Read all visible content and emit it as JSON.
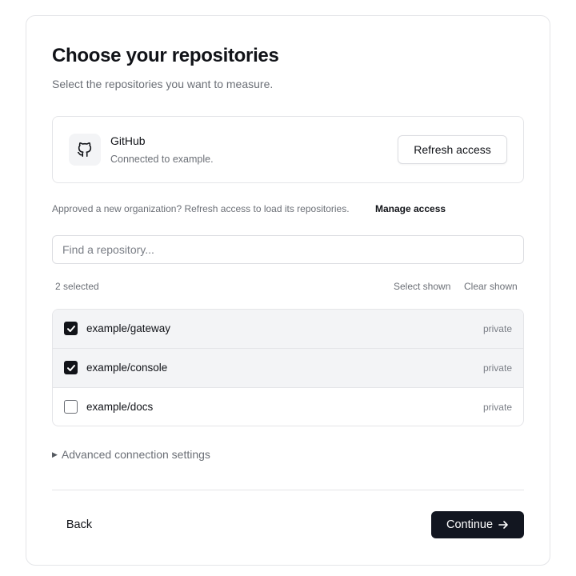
{
  "header": {
    "title": "Choose your repositories",
    "subtitle": "Select the repositories you want to measure."
  },
  "provider": {
    "icon": "github-icon",
    "name": "GitHub",
    "status": "Connected to example.",
    "refresh_label": "Refresh access"
  },
  "access_note": {
    "text": "Approved a new organization? Refresh access to load its repositories.",
    "link_label": "Manage access"
  },
  "search": {
    "placeholder": "Find a repository...",
    "value": ""
  },
  "selection": {
    "count_label": "2 selected",
    "select_shown_label": "Select shown",
    "clear_shown_label": "Clear shown"
  },
  "repositories": [
    {
      "name": "example/gateway",
      "visibility": "private",
      "checked": true
    },
    {
      "name": "example/console",
      "visibility": "private",
      "checked": true
    },
    {
      "name": "example/docs",
      "visibility": "private",
      "checked": false
    }
  ],
  "advanced": {
    "label": "Advanced connection settings",
    "expanded": false
  },
  "footer": {
    "back_label": "Back",
    "continue_label": "Continue",
    "continue_icon": "arrow-right-icon"
  },
  "colors": {
    "primary_button": "#121620",
    "border": "#e4e5e8",
    "muted_text": "#6b6f76",
    "selected_row": "#f3f4f6"
  }
}
